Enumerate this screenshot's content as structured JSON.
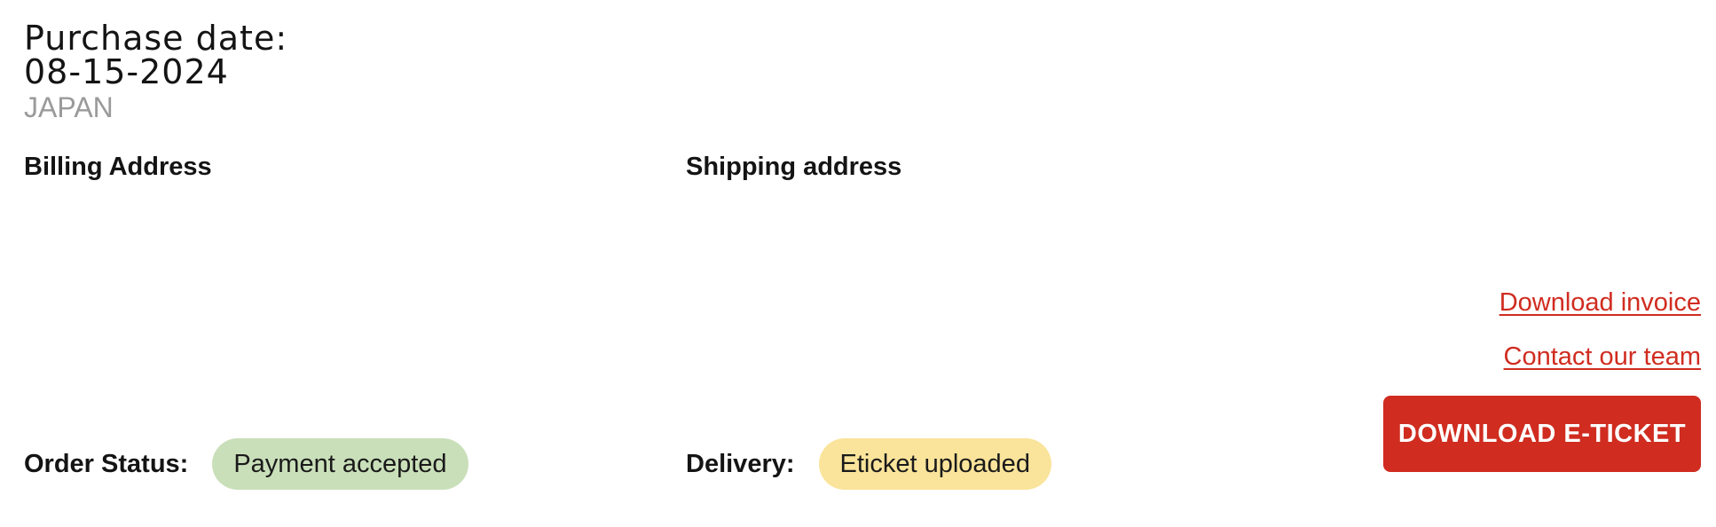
{
  "purchase": {
    "label": "Purchase date:",
    "date": "08-15-2024",
    "country": "JAPAN"
  },
  "billing": {
    "heading": "Billing Address"
  },
  "shipping": {
    "heading": "Shipping address"
  },
  "actions": {
    "download_invoice": "Download invoice",
    "contact_team": "Contact our team",
    "download_eticket": "DOWNLOAD E-TICKET"
  },
  "order_status": {
    "label": "Order Status:",
    "value": "Payment accepted",
    "badge_color": "#c9dfb9"
  },
  "delivery": {
    "label": "Delivery:",
    "value": "Eticket uploaded",
    "badge_color": "#fae49b"
  },
  "colors": {
    "accent": "#d02c20",
    "muted_text": "#9a9a9a"
  }
}
